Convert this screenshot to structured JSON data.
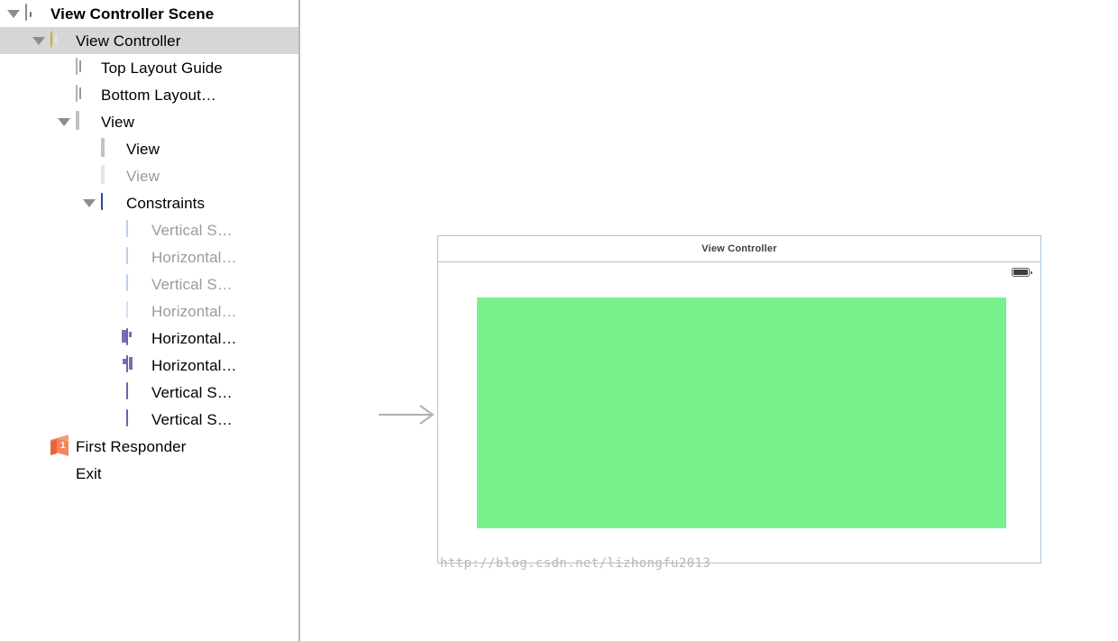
{
  "outline": {
    "rows": [
      {
        "label": "View Controller Scene",
        "icon": "scene-icon",
        "indent": 8,
        "twisty": true,
        "selected": false,
        "bold": true,
        "dim": false
      },
      {
        "label": "View Controller",
        "icon": "view-controller-icon",
        "indent": 36,
        "twisty": true,
        "selected": true,
        "bold": false,
        "dim": false
      },
      {
        "label": "Top Layout Guide",
        "icon": "top-layout-guide-icon",
        "indent": 64,
        "twisty": false,
        "selected": false,
        "bold": false,
        "dim": false
      },
      {
        "label": "Bottom Layout…",
        "icon": "bottom-layout-guide-icon",
        "indent": 64,
        "twisty": false,
        "selected": false,
        "bold": false,
        "dim": false
      },
      {
        "label": "View",
        "icon": "view-icon",
        "indent": 64,
        "twisty": true,
        "selected": false,
        "bold": false,
        "dim": false
      },
      {
        "label": "View",
        "icon": "view-icon",
        "indent": 92,
        "twisty": false,
        "selected": false,
        "bold": false,
        "dim": false
      },
      {
        "label": "View",
        "icon": "view-icon-faint",
        "indent": 92,
        "twisty": false,
        "selected": false,
        "bold": false,
        "dim": true
      },
      {
        "label": "Constraints",
        "icon": "constraints-icon",
        "indent": 92,
        "twisty": true,
        "selected": false,
        "bold": false,
        "dim": false
      },
      {
        "label": "Vertical S…",
        "icon": "constraint-pale-icon",
        "indent": 120,
        "twisty": false,
        "selected": false,
        "bold": false,
        "dim": true
      },
      {
        "label": "Horizontal…",
        "icon": "constraint-pale-icon",
        "indent": 120,
        "twisty": false,
        "selected": false,
        "bold": false,
        "dim": true
      },
      {
        "label": "Vertical S…",
        "icon": "constraint-pale-icon",
        "indent": 120,
        "twisty": false,
        "selected": false,
        "bold": false,
        "dim": true
      },
      {
        "label": "Horizontal…",
        "icon": "constraint-fainter-icon",
        "indent": 120,
        "twisty": false,
        "selected": false,
        "bold": false,
        "dim": true
      },
      {
        "label": "Horizontal…",
        "icon": "constraint-h-leading-icon",
        "indent": 120,
        "twisty": false,
        "selected": false,
        "bold": false,
        "dim": false
      },
      {
        "label": "Horizontal…",
        "icon": "constraint-h-trailing-icon",
        "indent": 120,
        "twisty": false,
        "selected": false,
        "bold": false,
        "dim": false
      },
      {
        "label": "Vertical S…",
        "icon": "constraint-v-top-icon",
        "indent": 120,
        "twisty": false,
        "selected": false,
        "bold": false,
        "dim": false
      },
      {
        "label": "Vertical S…",
        "icon": "constraint-v-bottom-icon",
        "indent": 120,
        "twisty": false,
        "selected": false,
        "bold": false,
        "dim": false
      },
      {
        "label": "First Responder",
        "icon": "first-responder-icon",
        "indent": 36,
        "twisty": false,
        "selected": false,
        "bold": false,
        "dim": false
      },
      {
        "label": "Exit",
        "icon": "exit-icon",
        "indent": 36,
        "twisty": false,
        "selected": false,
        "bold": false,
        "dim": false
      }
    ]
  },
  "canvas": {
    "title": "View Controller",
    "watermark": "http://blog.csdn.net/lizhongfu2013",
    "green_view_color": "#78F08C",
    "frame_border_color": "#A8C4DD",
    "status_bar": {
      "battery": "battery-icon"
    },
    "entry_arrow": "entry-point-arrow"
  },
  "colors": {
    "selection": "#D6D6D6",
    "accent_blue": "#2F6FD0",
    "constraint_purple": "#9B8FD0",
    "responder_orange": "#F4763F"
  }
}
